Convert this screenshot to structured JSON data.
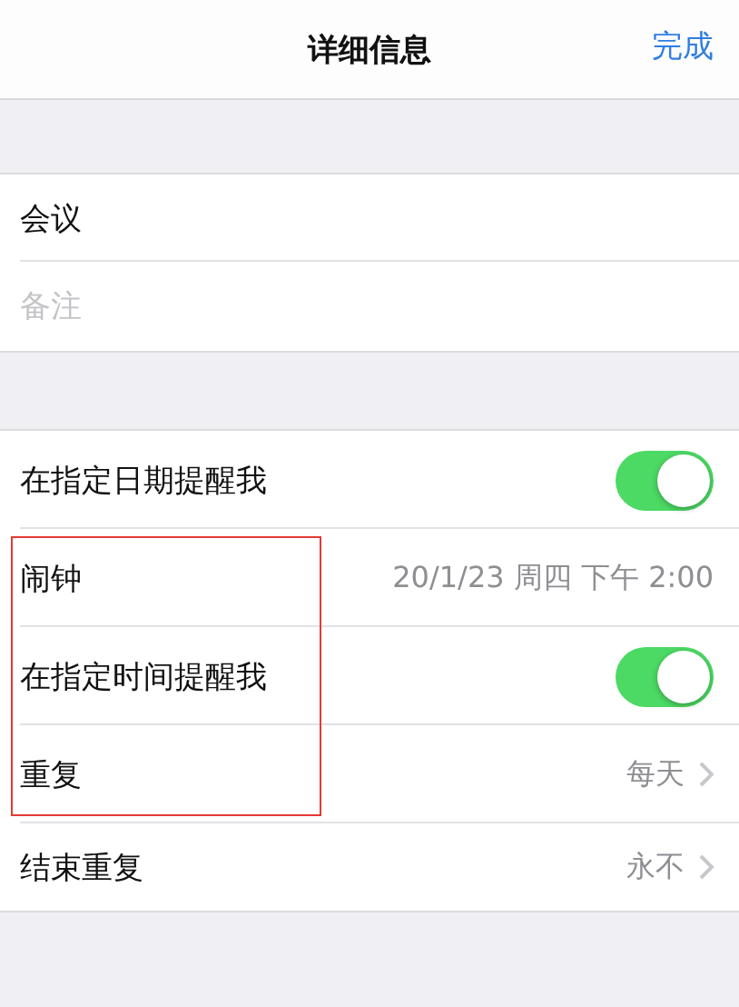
{
  "nav_bar": {
    "title": "详细信息",
    "done_button": "完成"
  },
  "fields": [
    {
      "kind": "title",
      "text": "会议"
    },
    {
      "kind": "placeholder",
      "placeholder": "备注"
    }
  ],
  "reminder_rows": [
    {
      "kind": "toggle",
      "label": "在指定日期提醒我",
      "on": true,
      "highlighted": false
    },
    {
      "kind": "value",
      "label": "闹钟",
      "value": "20/1/23 周四 下午 2:00",
      "highlighted": true
    },
    {
      "kind": "toggle",
      "label": "在指定时间提醒我",
      "on": true,
      "highlighted": true
    },
    {
      "kind": "link",
      "label": "重复",
      "value": "每天",
      "highlighted": true
    },
    {
      "kind": "link",
      "label": "结束重复",
      "value": "永不",
      "highlighted": false
    }
  ]
}
